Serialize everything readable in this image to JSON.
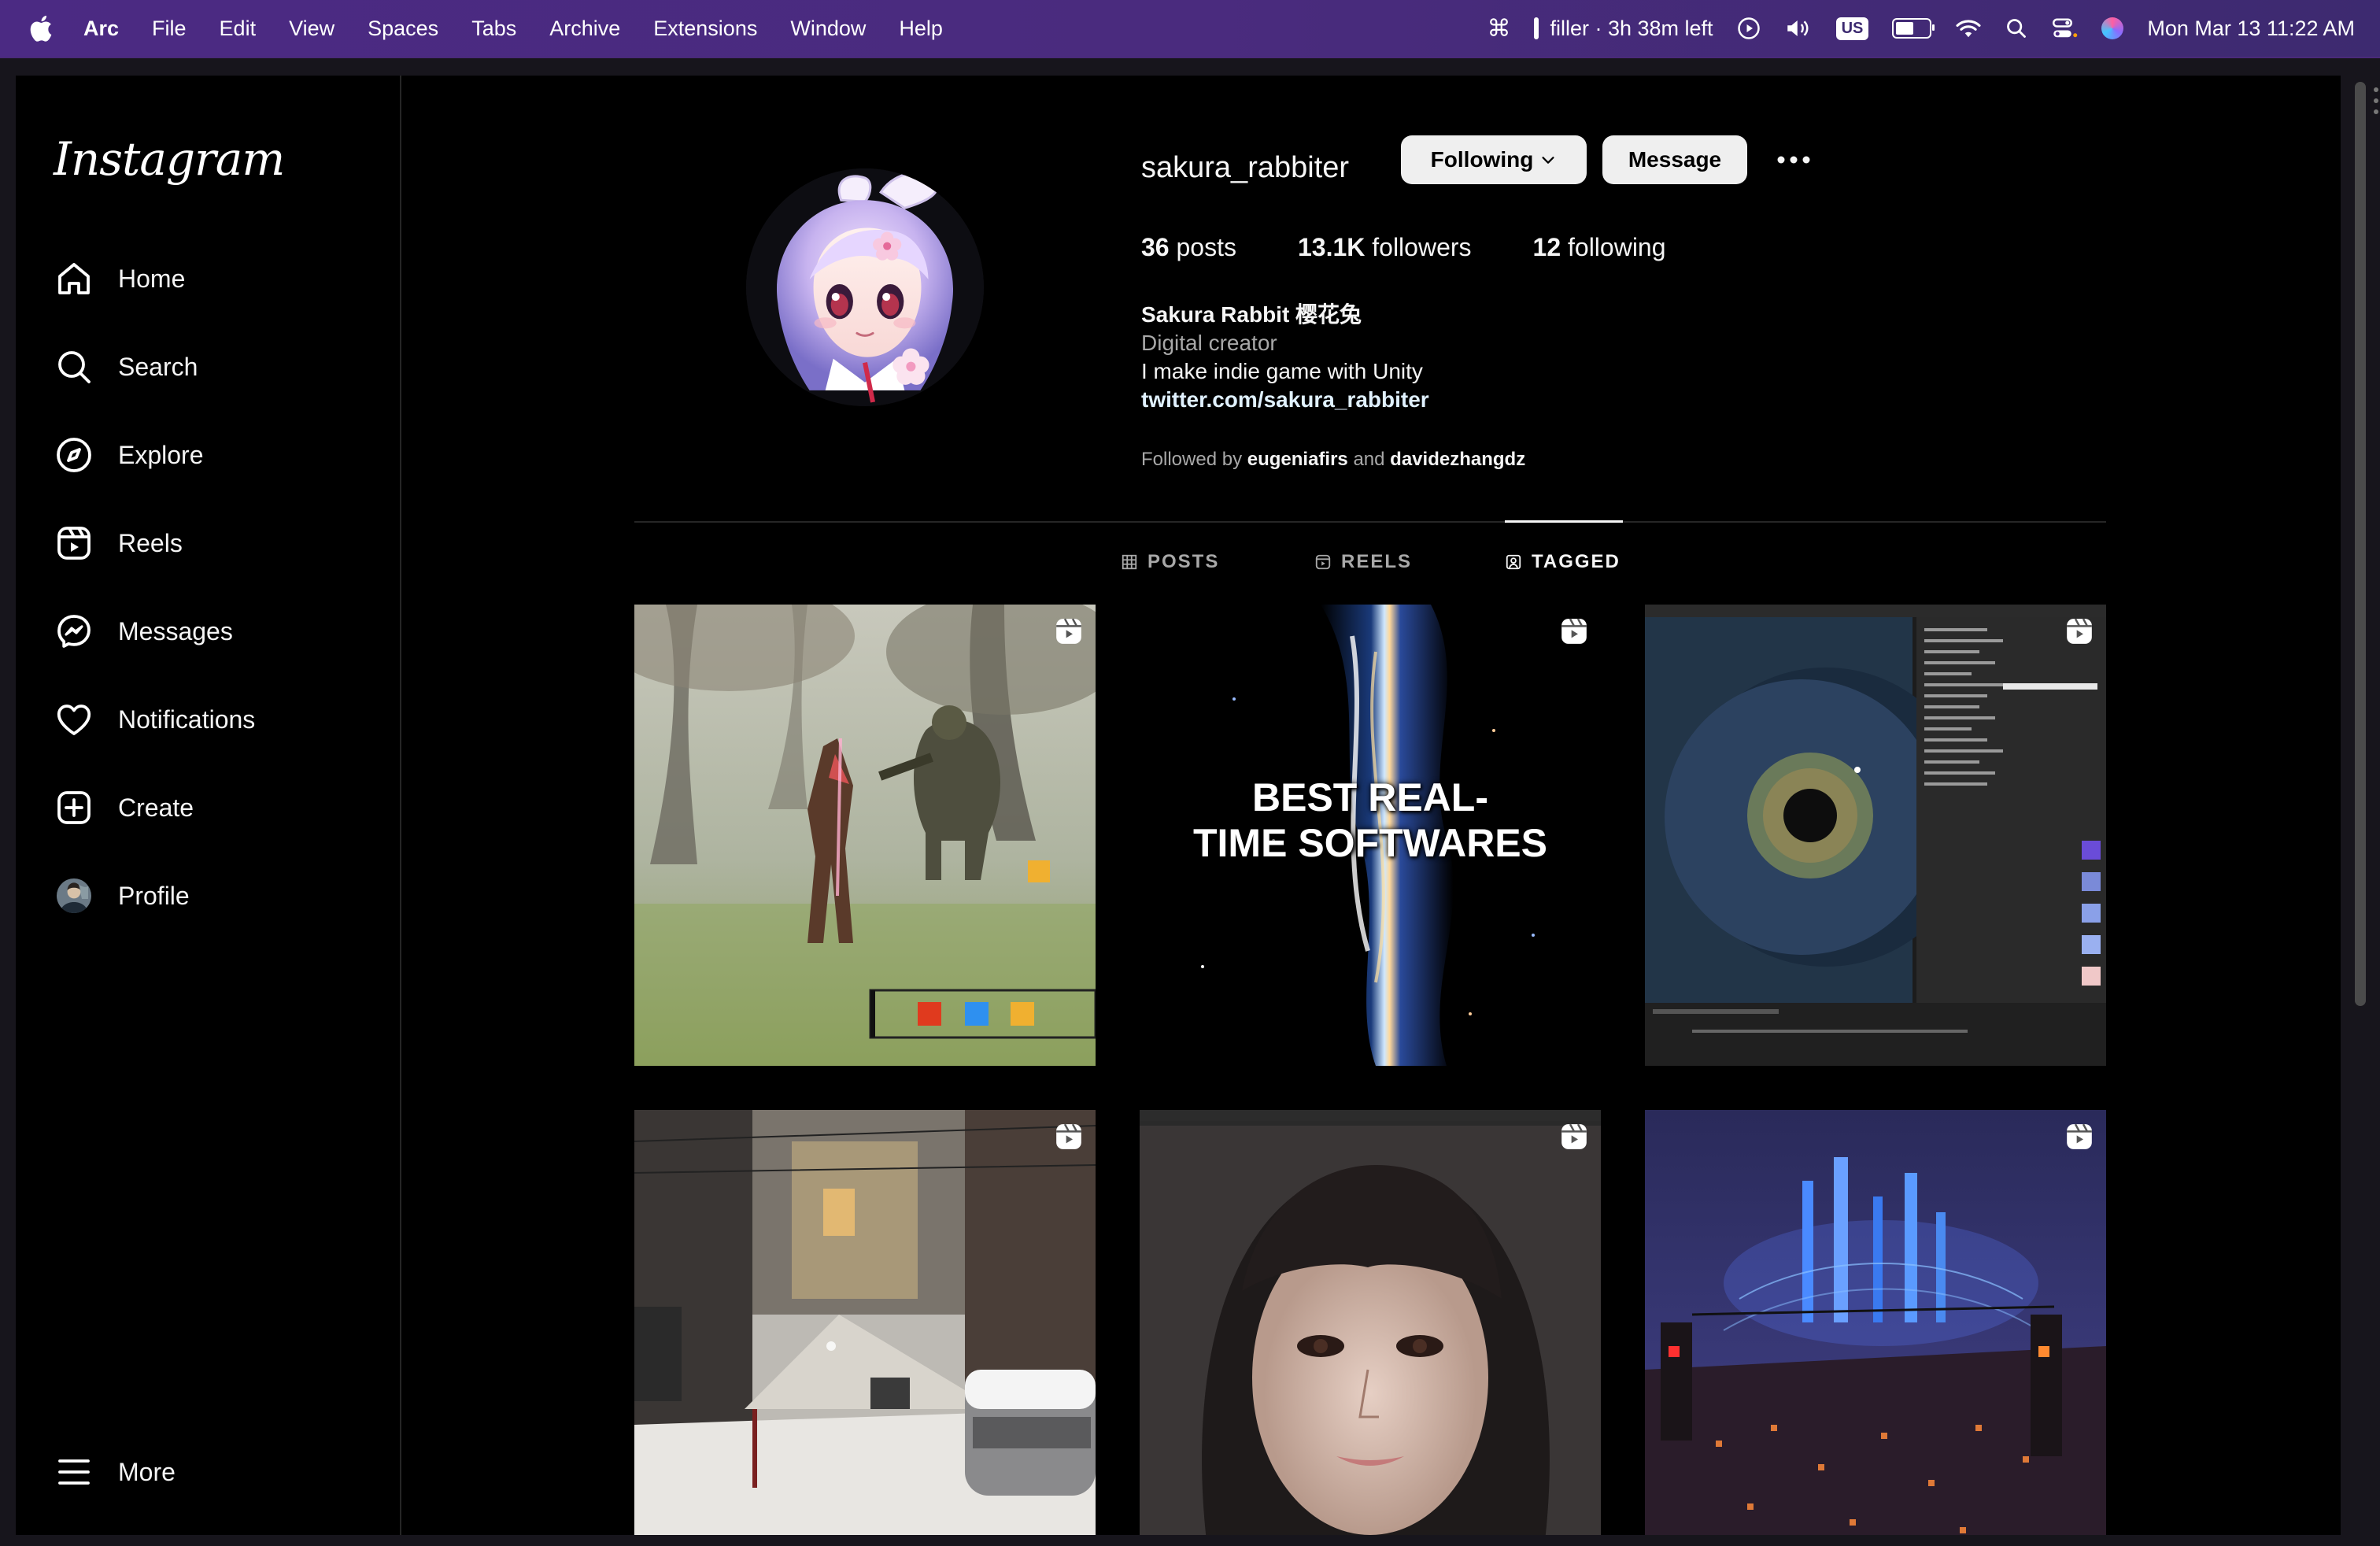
{
  "menubar": {
    "app_name": "Arc",
    "items": [
      "File",
      "Edit",
      "View",
      "Spaces",
      "Tabs",
      "Archive",
      "Extensions",
      "Window",
      "Help"
    ],
    "timer": "filler · 3h 38m left",
    "keyboard": "US",
    "datetime": "Mon Mar 13  11:22 AM",
    "battery_level": 0.6
  },
  "sidebar": {
    "logo": "Instagram",
    "nav": [
      {
        "label": "Home",
        "icon": "home-icon"
      },
      {
        "label": "Search",
        "icon": "search-icon"
      },
      {
        "label": "Explore",
        "icon": "compass-icon"
      },
      {
        "label": "Reels",
        "icon": "reels-icon"
      },
      {
        "label": "Messages",
        "icon": "messenger-icon"
      },
      {
        "label": "Notifications",
        "icon": "heart-icon"
      },
      {
        "label": "Create",
        "icon": "plus-square-icon"
      },
      {
        "label": "Profile",
        "icon": "profile-avatar-icon"
      }
    ],
    "more": "More"
  },
  "profile": {
    "username": "sakura_rabbiter",
    "following_button": "Following",
    "message_button": "Message",
    "posts_count": "36",
    "posts_label": "posts",
    "followers_count": "13.1K",
    "followers_label": "followers",
    "following_count": "12",
    "following_label": "following",
    "display_name": "Sakura Rabbit 樱花兔",
    "category": "Digital creator",
    "bio_line": "I make indie game with Unity",
    "link": "twitter.com/sakura_rabbiter",
    "followed_by_prefix": "Followed by",
    "followed_by_user1": "eugeniafirs",
    "followed_by_and": "and",
    "followed_by_user2": "davidezhangdz"
  },
  "tabs": [
    {
      "label": "POSTS",
      "active": false
    },
    {
      "label": "REELS",
      "active": false
    },
    {
      "label": "TAGGED",
      "active": true
    }
  ],
  "grid": {
    "tiles": [
      {
        "desc": "forest-battle-game",
        "reel": true
      },
      {
        "desc": "best-real-time-softwares",
        "reel": true,
        "overlay_text_1": "BEST REAL-",
        "overlay_text_2": "TIME SOFTWARES"
      },
      {
        "desc": "eye-shader-editor",
        "reel": true
      },
      {
        "desc": "snowy-street",
        "reel": true
      },
      {
        "desc": "realistic-girl-portrait",
        "reel": true
      },
      {
        "desc": "cyberpunk-city",
        "reel": true
      }
    ]
  },
  "colors": {
    "menubar": "#4b2a83",
    "background": "#000000",
    "button": "#efefef",
    "muted_text": "#a8a8a8"
  }
}
